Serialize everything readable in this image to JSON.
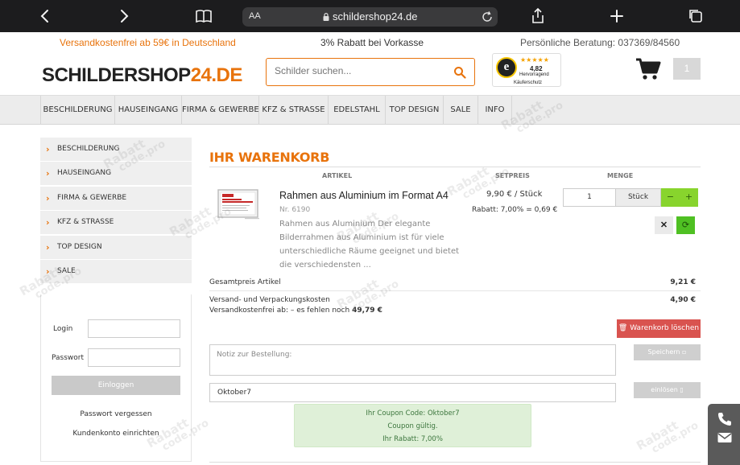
{
  "browser": {
    "aa": "AA",
    "url": "schildershop24.de"
  },
  "info_bar": {
    "free_shipping": "Versandkostenfrei ab 59€ in Deutschland",
    "discount": "3% Rabatt bei Vorkasse",
    "phone": "Persönliche Beratung: 037369/84560"
  },
  "header": {
    "logo_part1": "SCHILDERSHOP",
    "logo_part2": "24.DE",
    "search_placeholder": "Schilder suchen...",
    "trust": {
      "stars": "★★★★★",
      "score": "4,82",
      "rating": "Hervorragend",
      "protection": "Käuferschutz"
    },
    "cart_count": "1"
  },
  "nav": {
    "items": [
      "Beschilderung",
      "Hauseingang",
      "Firma & Gewerbe",
      "KFZ & Strasse",
      "Edelstahl",
      "Top Design",
      "Sale",
      "Info"
    ]
  },
  "sidebar": {
    "items": [
      "Beschilderung",
      "Hauseingang",
      "Firma & Gewerbe",
      "KFZ & Strasse",
      "Top Design",
      "Sale"
    ],
    "login_label": "Login",
    "password_label": "Passwort",
    "login_button": "Einloggen",
    "forgot_password": "Passwort vergessen",
    "create_account": "Kundenkonto einrichten"
  },
  "cart": {
    "title": "IHR WARENKORB",
    "col_article": "ARTIKEL",
    "col_price": "SETPREIS",
    "col_qty": "MENGE",
    "item": {
      "name": "Rahmen aus Aluminium im Format A4",
      "number": "Nr. 6190",
      "description": "Rahmen aus Aluminium Der elegante Bilderrahmen aus Aluminium ist für viele unterschiedliche Räume geeignet und bietet die verschiedensten ...",
      "unit_price": "9,90 € / Stück",
      "discount": "Rabatt: 7,00% = 0,69 €",
      "quantity": "1",
      "unit": "Stück"
    },
    "total_label": "Gesamtpreis Artikel",
    "total_value": "9,21 €",
    "shipping_label": "Versand- und Verpackungskosten",
    "shipping_value": "4,90 €",
    "free_shipping_prefix": "Versandkostenfrei ab: – es fehlen noch",
    "free_shipping_missing": "49,79 €",
    "clear_cart": "Warenkorb löschen",
    "note_placeholder": "Notiz zur Bestellung:",
    "save_button": "Speichern",
    "coupon_value": "Oktober7",
    "redeem_button": "einlösen",
    "coupon_msg_code": "Ihr Coupon Code: Oktober7",
    "coupon_msg_valid": "Coupon gültig.",
    "coupon_msg_discount": "Ihr Rabatt: 7,00%"
  },
  "watermark": {
    "line1": "Rabatt",
    "line2": "code.pro"
  },
  "colors": {
    "accent": "#e8730c",
    "success": "#88d42d",
    "danger": "#d9534f"
  }
}
